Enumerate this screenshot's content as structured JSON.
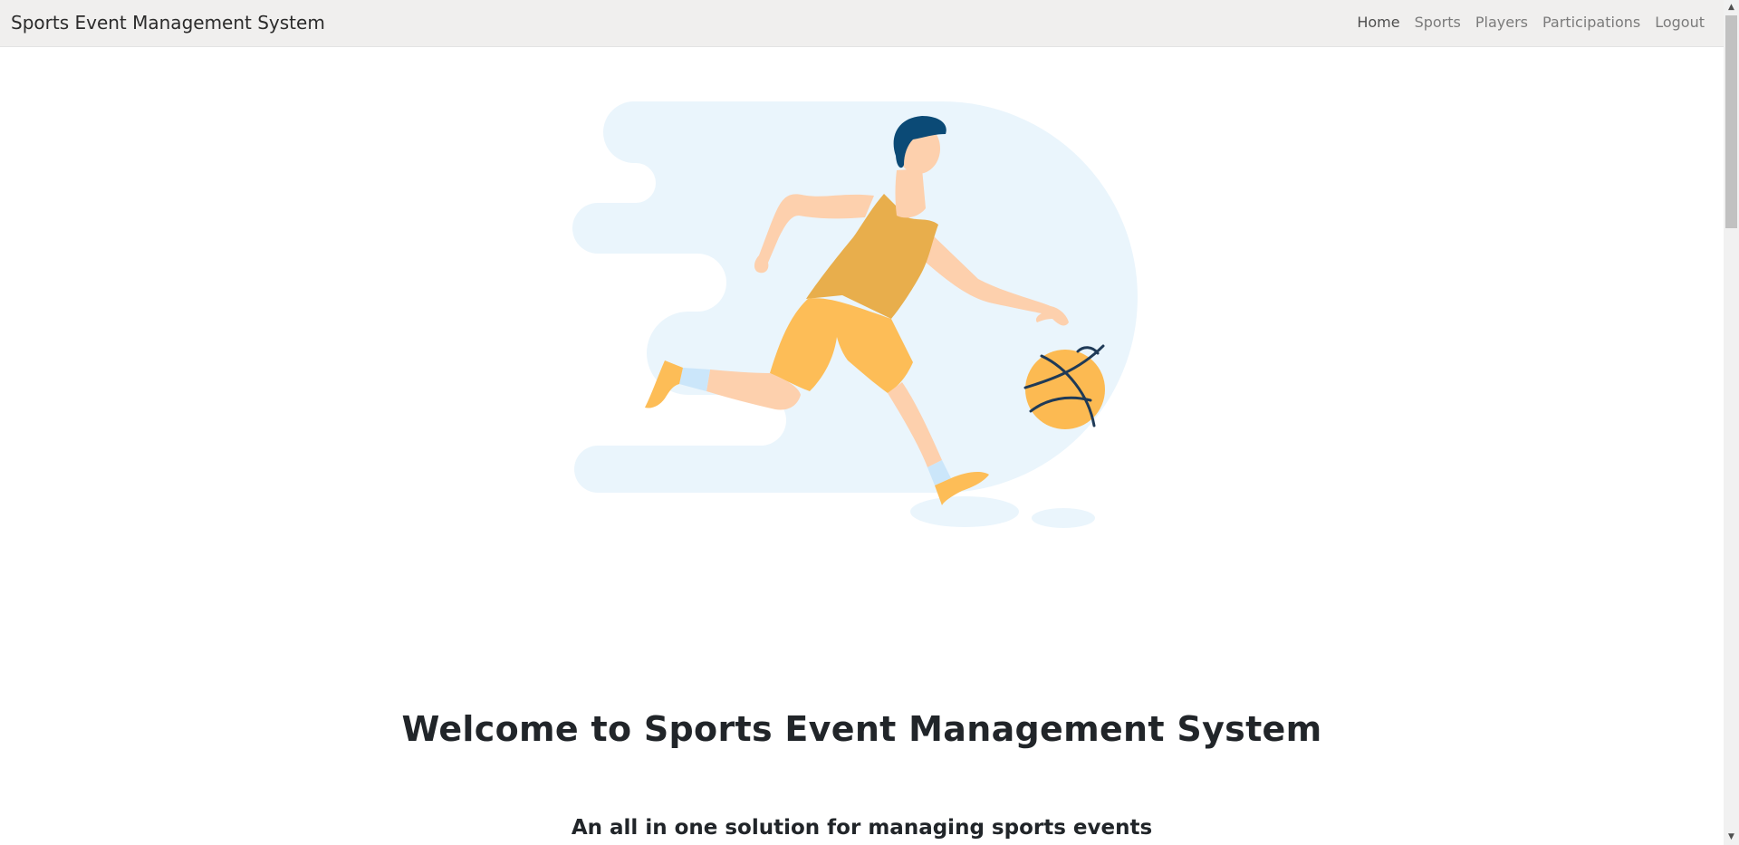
{
  "navbar": {
    "brand": "Sports Event Management System",
    "links": [
      {
        "label": "Home",
        "active": true
      },
      {
        "label": "Sports",
        "active": false
      },
      {
        "label": "Players",
        "active": false
      },
      {
        "label": "Participations",
        "active": false
      },
      {
        "label": "Logout",
        "active": false
      }
    ]
  },
  "hero": {
    "illustration": "basketball-player-illustration",
    "colors": {
      "background_blob": "#eaf5fc",
      "jersey": "#e8ae4c",
      "shorts": "#fdbd57",
      "skin": "#fdd0ad",
      "hair": "#0b4a76",
      "ball": "#fcba52",
      "ball_lines": "#1f3a57",
      "socks": "#cbe6fa"
    }
  },
  "main": {
    "title": "Welcome to Sports Event Management System",
    "subtitle": "An all in one solution for managing sports events"
  }
}
